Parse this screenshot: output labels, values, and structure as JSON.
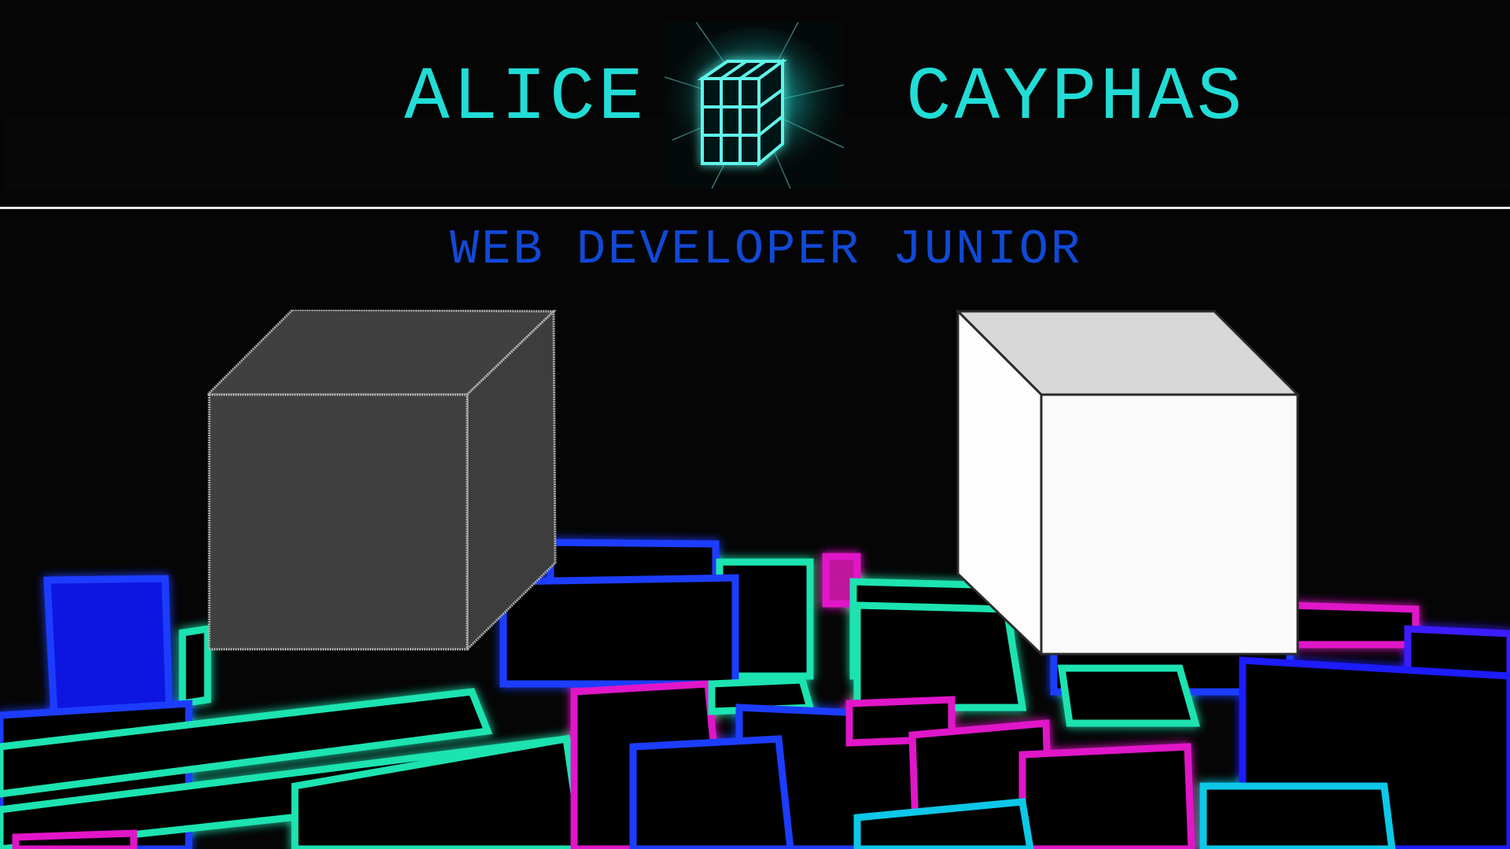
{
  "header": {
    "first_name": "ALICE",
    "last_name": "CAYPHAS",
    "subtitle": "WEB DEVELOPER JUNIOR"
  },
  "icons": {
    "logo": "glowing-cube-icon"
  },
  "colors": {
    "name_text": "#22dcd6",
    "subtitle_text": "#1149d6",
    "background": "#000000",
    "divider": "#e8e8e8",
    "cube_dark": "#404040",
    "cube_light": "#fafafa",
    "neon_green": "#1fe3b0",
    "neon_blue": "#1a3cff",
    "neon_magenta": "#e015c8",
    "neon_cyan": "#10c8e8"
  },
  "cubes": [
    {
      "id": "dark",
      "tone": "dark"
    },
    {
      "id": "light",
      "tone": "light"
    }
  ]
}
